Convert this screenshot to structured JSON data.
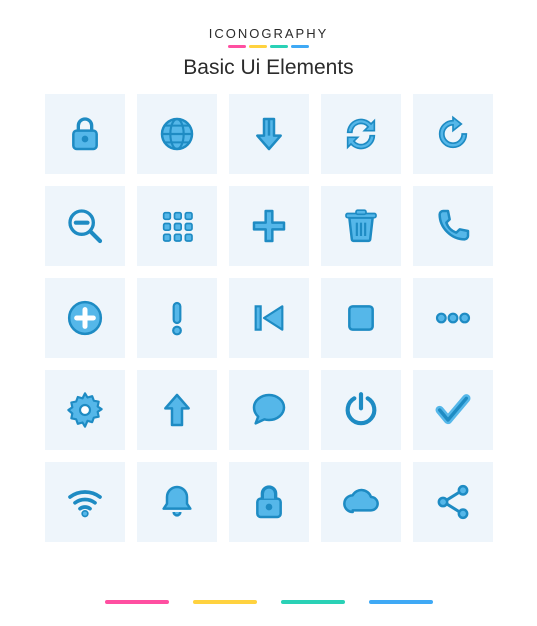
{
  "brand": "ICONOGRAPHY",
  "title": "Basic Ui Elements",
  "brand_bar_colors": [
    "#ff4fa1",
    "#ffd23f",
    "#2ad1b6",
    "#3fa9f5"
  ],
  "footer_bar_colors": [
    "#ff4fa1",
    "#ffd23f",
    "#2ad1b6",
    "#3fa9f5"
  ],
  "icon_color_fill": "#55b7e9",
  "icon_color_stroke": "#1e8bc3",
  "tile_bg": "#eef5fb",
  "icons": [
    {
      "name": "lock-icon"
    },
    {
      "name": "globe-icon"
    },
    {
      "name": "arrow-down-icon"
    },
    {
      "name": "refresh-icon"
    },
    {
      "name": "reload-icon"
    },
    {
      "name": "zoom-out-icon"
    },
    {
      "name": "grid-icon"
    },
    {
      "name": "plus-icon"
    },
    {
      "name": "trash-icon"
    },
    {
      "name": "phone-icon"
    },
    {
      "name": "plus-circle-icon"
    },
    {
      "name": "exclamation-icon"
    },
    {
      "name": "skip-back-icon"
    },
    {
      "name": "stop-icon"
    },
    {
      "name": "more-horizontal-icon"
    },
    {
      "name": "gear-icon"
    },
    {
      "name": "arrow-up-solid-icon"
    },
    {
      "name": "chat-icon"
    },
    {
      "name": "power-icon"
    },
    {
      "name": "check-icon"
    },
    {
      "name": "wifi-icon"
    },
    {
      "name": "bell-icon"
    },
    {
      "name": "lock-solid-icon"
    },
    {
      "name": "cloud-icon"
    },
    {
      "name": "share-icon"
    }
  ]
}
